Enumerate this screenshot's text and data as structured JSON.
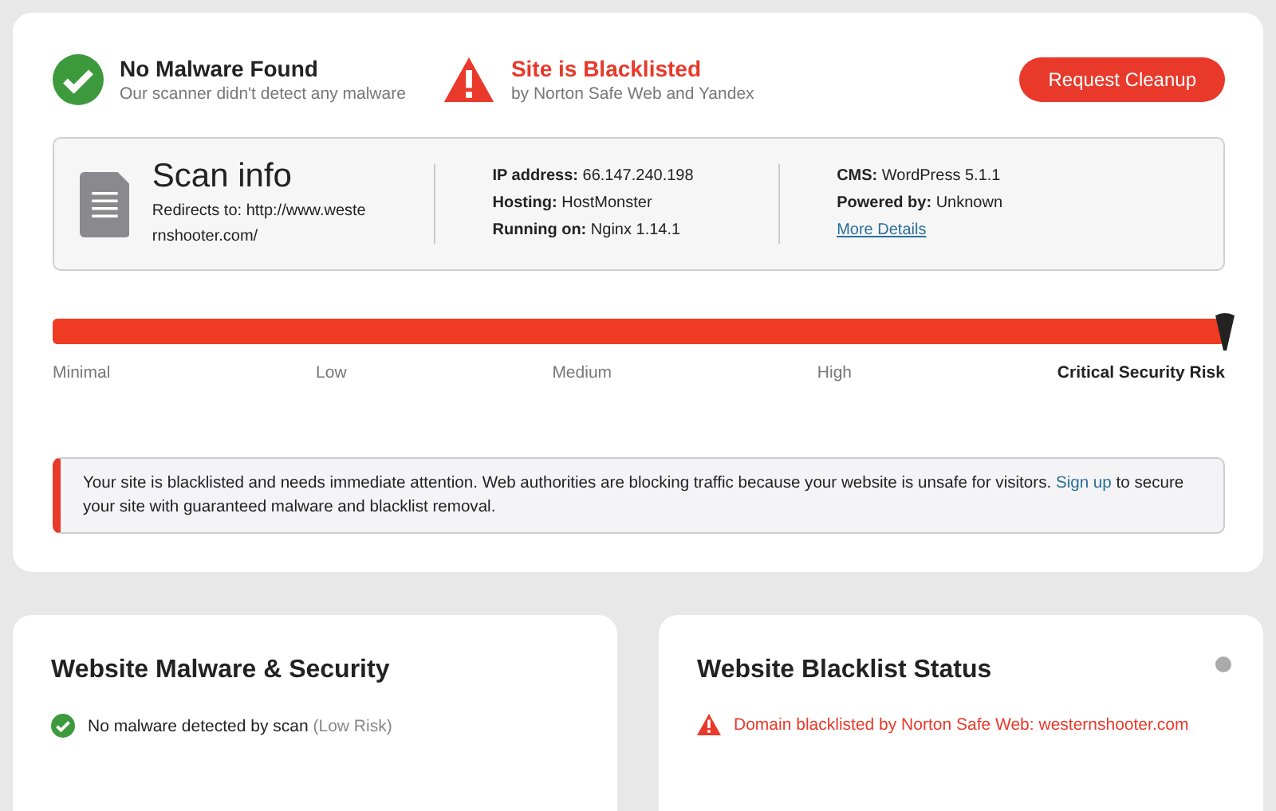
{
  "summary": [
    {
      "kind": "ok",
      "title": "No Malware Found",
      "subtitle": "Our scanner didn't detect any malware"
    },
    {
      "kind": "alert",
      "title": "Site is Blacklisted",
      "subtitle": "by Norton Safe Web and Yandex"
    }
  ],
  "cleanup_button": "Request Cleanup",
  "scan_info": {
    "title": "Scan info",
    "redirect": "Redirects to: http://www.weste rnshooter.com/",
    "columns": [
      [
        {
          "label": "IP address:",
          "value": "66.147.240.198"
        },
        {
          "label": "Hosting:",
          "value": "HostMonster"
        },
        {
          "label": "Running on:",
          "value": "Nginx 1.14.1"
        }
      ],
      [
        {
          "label": "CMS:",
          "value": "WordPress 5.1.1"
        },
        {
          "label": "Powered by:",
          "value": "Unknown"
        }
      ]
    ],
    "link": "More Details"
  },
  "risk_meter": {
    "level": 1,
    "labels": [
      {
        "text": "Minimal",
        "selected": false
      },
      {
        "text": "Low",
        "selected": false
      },
      {
        "text": "Medium",
        "selected": false
      },
      {
        "text": "High",
        "selected": false
      },
      {
        "text": "Critical Security Risk",
        "selected": true
      }
    ]
  },
  "alert": {
    "before": "Your site is blacklisted and needs immediate attention. Web authorities are blocking traffic because your website is unsafe for visitors.",
    "link": "Sign up",
    "after": "to secure your site with guaranteed malware and blacklist removal."
  },
  "panels": [
    {
      "title": "Website Malware & Security",
      "help": false,
      "items": [
        {
          "kind": "ok",
          "text": "No malware detected by scan",
          "note": "(Low Risk)"
        }
      ]
    },
    {
      "title": "Website Blacklist Status",
      "help": true,
      "items": [
        {
          "kind": "alert",
          "text": "Domain blacklisted by Norton Safe Web: westernshooter.com"
        }
      ]
    }
  ]
}
